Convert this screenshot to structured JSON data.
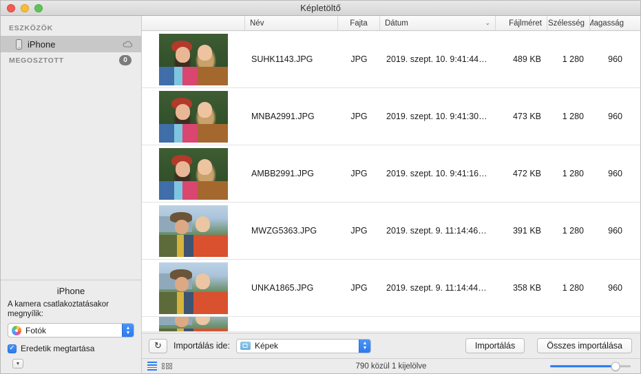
{
  "window": {
    "title": "Képletöltő",
    "traffic_lights": [
      "close-button",
      "minimize-button",
      "maximize-button"
    ]
  },
  "sidebar": {
    "sections": [
      {
        "header": "ESZKÖZÖK",
        "badge": null
      },
      {
        "header": "MEGOSZTOTT",
        "badge": "0"
      }
    ],
    "devices": [
      {
        "label": "iPhone",
        "selected": true,
        "icon": "iphone-icon",
        "accessory": "cloud-icon"
      }
    ],
    "device_panel": {
      "name": "iPhone",
      "description": "A kamera csatlakoztatásakor megnyílik:",
      "app_popup_value": "Fotók",
      "keep_originals_label": "Eredetik megtartása",
      "keep_originals_checked": true,
      "check_glyph": "✓"
    }
  },
  "table": {
    "columns": [
      {
        "key": "thumb",
        "label": ""
      },
      {
        "key": "name",
        "label": "Név"
      },
      {
        "key": "kind",
        "label": "Fajta"
      },
      {
        "key": "date",
        "label": "Dátum",
        "sorted": true,
        "sort_glyph": "⌄"
      },
      {
        "key": "size",
        "label": "Fájlméret"
      },
      {
        "key": "width",
        "label": "Szélesség"
      },
      {
        "key": "height",
        "label": "Magasság"
      }
    ],
    "rows": [
      {
        "name": "SUHK1143.JPG",
        "kind": "JPG",
        "date": "2019. szept. 10. 9:41:44…",
        "size": "489 KB",
        "width": "1 280",
        "height": "960",
        "scene": "a"
      },
      {
        "name": "MNBA2991.JPG",
        "kind": "JPG",
        "date": "2019. szept. 10. 9:41:30…",
        "size": "473 KB",
        "width": "1 280",
        "height": "960",
        "scene": "a"
      },
      {
        "name": "AMBB2991.JPG",
        "kind": "JPG",
        "date": "2019. szept. 10. 9:41:16…",
        "size": "472 KB",
        "width": "1 280",
        "height": "960",
        "scene": "a"
      },
      {
        "name": "MWZG5363.JPG",
        "kind": "JPG",
        "date": "2019. szept. 9. 11:14:46…",
        "size": "391 KB",
        "width": "1 280",
        "height": "960",
        "scene": "b"
      },
      {
        "name": "UNKA1865.JPG",
        "kind": "JPG",
        "date": "2019. szept. 9. 11:14:44…",
        "size": "358 KB",
        "width": "1 280",
        "height": "960",
        "scene": "b"
      }
    ]
  },
  "import_bar": {
    "rotate_glyph": "↻",
    "label": "Importálás ide:",
    "destination_value": "Képek",
    "import_button": "Importálás",
    "import_all_button": "Összes importálása"
  },
  "status_bar": {
    "text": "790 közül 1 kijelölve",
    "list_view_active": true,
    "slider_value": 81
  },
  "colors": {
    "accent": "#2a7bf2",
    "sidebar_bg": "#ececec",
    "selection": "#c8c8c8",
    "badge": "#7b7b7b"
  }
}
